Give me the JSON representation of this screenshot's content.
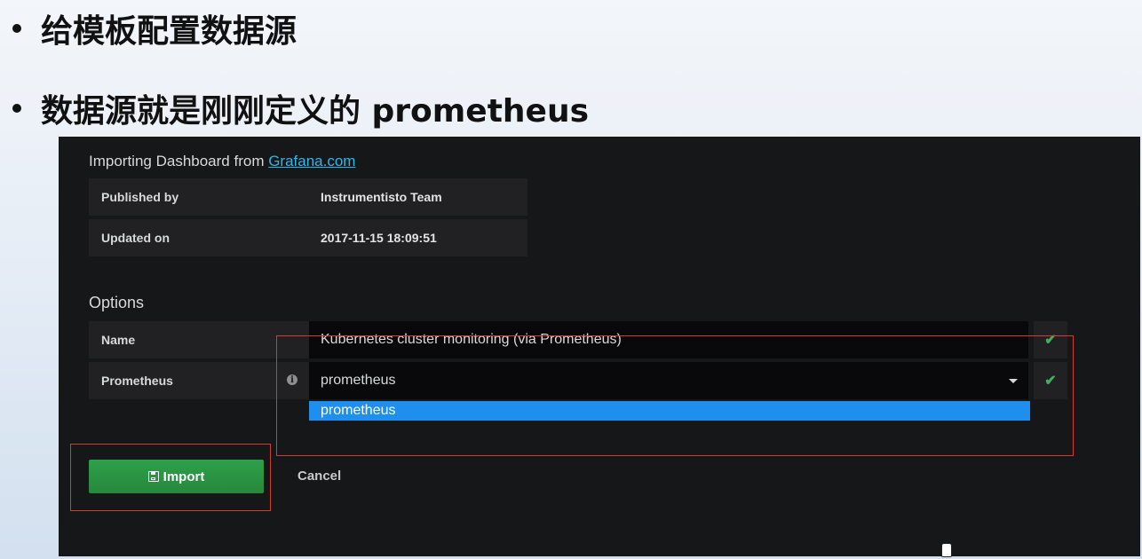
{
  "slide": {
    "bullet1": "给模板配置数据源",
    "bullet2": "数据源就是刚刚定义的 prometheus"
  },
  "import_panel": {
    "heading_prefix": "Importing Dashboard from ",
    "heading_link": "Grafana.com",
    "published_by_label": "Published by",
    "published_by_value": "Instrumentisto Team",
    "updated_on_label": "Updated on",
    "updated_on_value": "2017-11-15 18:09:51"
  },
  "options": {
    "title": "Options",
    "name_label": "Name",
    "name_value": "Kubernetes cluster monitoring (via Prometheus)",
    "prometheus_label": "Prometheus",
    "prometheus_value": "prometheus",
    "dropdown_options": [
      "prometheus"
    ]
  },
  "actions": {
    "import_label": "Import",
    "cancel_label": "Cancel"
  },
  "icons": {
    "info": "info-icon",
    "check": "check-icon",
    "save": "save-icon",
    "caret": "caret-down-icon"
  },
  "colors": {
    "panel_bg": "#161719",
    "row_bg": "#212124",
    "input_bg": "#09090b",
    "link": "#33b5e5",
    "check_green": "#3eb15b",
    "import_green": "#2ea04a",
    "highlight_blue": "#1f8fef",
    "annotation_red": "#d63a36"
  }
}
